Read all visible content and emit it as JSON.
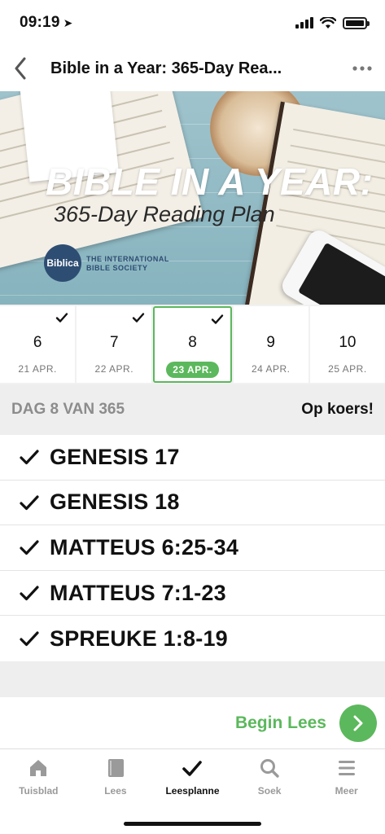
{
  "status_bar": {
    "time": "09:19",
    "location_glyph": "➤"
  },
  "nav": {
    "title": "Bible in a Year: 365-Day Rea..."
  },
  "hero": {
    "title": "BIBLE IN A YEAR:",
    "subtitle": "365-Day Reading Plan",
    "logo_text": "Biblica",
    "publisher_line1": "THE INTERNATIONAL",
    "publisher_line2": "BIBLE SOCIETY"
  },
  "days": [
    {
      "num": "6",
      "date": "21 APR.",
      "completed": true,
      "selected": false
    },
    {
      "num": "7",
      "date": "22 APR.",
      "completed": true,
      "selected": false
    },
    {
      "num": "8",
      "date": "23 APR.",
      "completed": true,
      "selected": true
    },
    {
      "num": "9",
      "date": "24 APR.",
      "completed": false,
      "selected": false
    },
    {
      "num": "10",
      "date": "25 APR.",
      "completed": false,
      "selected": false
    }
  ],
  "progress": {
    "day_label": "DAG 8 VAN 365",
    "status": "Op koers!"
  },
  "readings": [
    {
      "label": "GENESIS 17",
      "completed": true
    },
    {
      "label": "GENESIS 18",
      "completed": true
    },
    {
      "label": "MATTEUS 6:25-34",
      "completed": true
    },
    {
      "label": "MATTEUS 7:1-23",
      "completed": true
    },
    {
      "label": "SPREUKE 1:8-19",
      "completed": true
    }
  ],
  "begin": {
    "label": "Begin Lees"
  },
  "tabs": [
    {
      "label": "Tuisblad",
      "icon": "home-icon",
      "active": false
    },
    {
      "label": "Lees",
      "icon": "book-icon",
      "active": false
    },
    {
      "label": "Leesplanne",
      "icon": "checkmark-icon",
      "active": true
    },
    {
      "label": "Soek",
      "icon": "search-icon",
      "active": false
    },
    {
      "label": "Meer",
      "icon": "menu-icon",
      "active": false
    }
  ],
  "colors": {
    "accent": "#5cb85c",
    "logo_blue": "#2e4d73",
    "muted_gray": "#8c8c8c"
  }
}
